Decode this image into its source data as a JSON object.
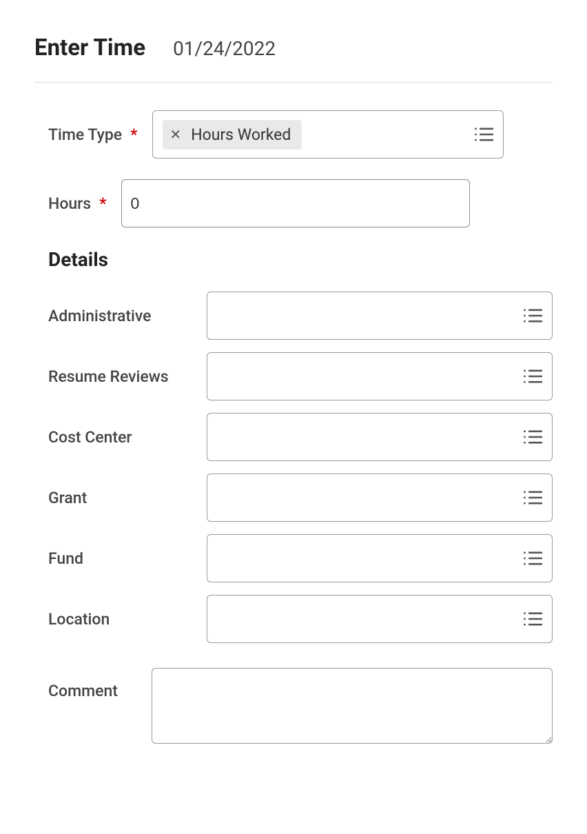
{
  "header": {
    "title": "Enter Time",
    "date": "01/24/2022"
  },
  "form": {
    "time_type_label": "Time Type",
    "time_type_chip": "Hours Worked",
    "hours_label": "Hours",
    "hours_value": "0"
  },
  "details": {
    "heading": "Details",
    "fields": [
      {
        "label": "Administrative",
        "name": "administrative"
      },
      {
        "label": "Resume Reviews",
        "name": "resume-reviews"
      },
      {
        "label": "Cost Center",
        "name": "cost-center"
      },
      {
        "label": "Grant",
        "name": "grant"
      },
      {
        "label": "Fund",
        "name": "fund"
      },
      {
        "label": "Location",
        "name": "location"
      }
    ]
  },
  "comment": {
    "label": "Comment",
    "value": ""
  }
}
